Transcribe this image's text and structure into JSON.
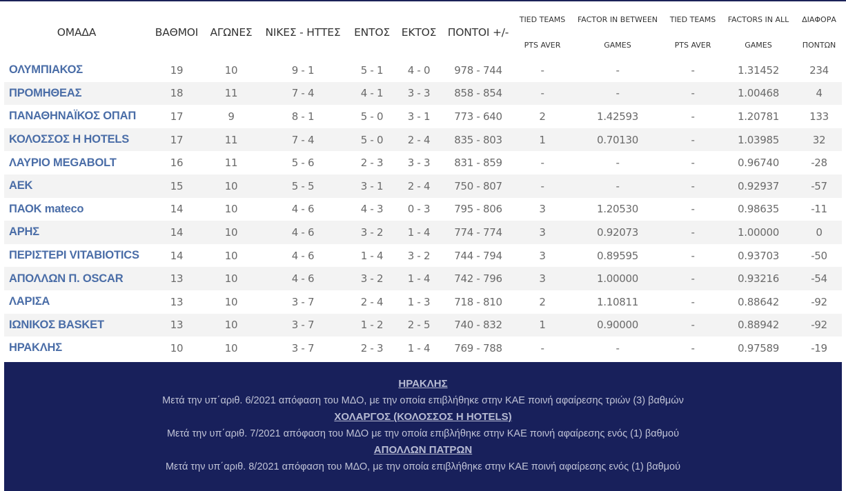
{
  "colors": {
    "team_link": "#4a6da7",
    "footer_bg": "#18205b",
    "row_stripe": "#f3f3f3"
  },
  "header": {
    "team": "ΟΜΑΔΑ",
    "points": "ΒΑΘΜΟΙ",
    "games": "ΑΓΩΝΕΣ",
    "win_loss": "ΝΙΚΕΣ - ΗΤΤΕΣ",
    "home": "ΕΝΤΟΣ",
    "away": "ΕΚΤΟΣ",
    "score": "ΠΟΝΤΟΙ +/-",
    "tied_teams_1_line1": "TIED TEAMS",
    "tied_teams_1_line2": "PTS AVER",
    "factor_between_line1": "FACTOR IN BETWEEN",
    "factor_between_line2": "GAMES",
    "tied_teams_2_line1": "TIED TEAMS",
    "tied_teams_2_line2": "PTS AVER",
    "factors_all_line1": "FACTORS IN ALL",
    "factors_all_line2": "GAMES",
    "diff_line1": "ΔΙΑΦΟΡΑ",
    "diff_line2": "ΠΟΝΤΩΝ"
  },
  "rows": [
    {
      "team": "ΟΛΥΜΠΙΑΚΟΣ",
      "points": "19",
      "games": "10",
      "wl": "9 - 1",
      "home": "5 - 1",
      "away": "4 - 0",
      "score": "978 - 744",
      "tied1": "-",
      "factor_between": "-",
      "tied2": "-",
      "factor_all": "1.31452",
      "diff": "234"
    },
    {
      "team": "ΠΡΟΜΗΘΕΑΣ",
      "points": "18",
      "games": "11",
      "wl": "7 - 4",
      "home": "4 - 1",
      "away": "3 - 3",
      "score": "858 - 854",
      "tied1": "-",
      "factor_between": "-",
      "tied2": "-",
      "factor_all": "1.00468",
      "diff": "4"
    },
    {
      "team": "ΠΑΝΑΘΗΝΑΪΚΟΣ ΟΠΑΠ",
      "points": "17",
      "games": "9",
      "wl": "8 - 1",
      "home": "5 - 0",
      "away": "3 - 1",
      "score": "773 - 640",
      "tied1": "2",
      "factor_between": "1.42593",
      "tied2": "-",
      "factor_all": "1.20781",
      "diff": "133"
    },
    {
      "team": "ΚΟΛΟΣΣΟΣ Η HOTELS",
      "points": "17",
      "games": "11",
      "wl": "7 - 4",
      "home": "5 - 0",
      "away": "2 - 4",
      "score": "835 - 803",
      "tied1": "1",
      "factor_between": "0.70130",
      "tied2": "-",
      "factor_all": "1.03985",
      "diff": "32"
    },
    {
      "team": "ΛΑΥΡΙΟ MEGABOLT",
      "points": "16",
      "games": "11",
      "wl": "5 - 6",
      "home": "2 - 3",
      "away": "3 - 3",
      "score": "831 - 859",
      "tied1": "-",
      "factor_between": "-",
      "tied2": "-",
      "factor_all": "0.96740",
      "diff": "-28"
    },
    {
      "team": "ΑΕΚ",
      "points": "15",
      "games": "10",
      "wl": "5 - 5",
      "home": "3 - 1",
      "away": "2 - 4",
      "score": "750 - 807",
      "tied1": "-",
      "factor_between": "-",
      "tied2": "-",
      "factor_all": "0.92937",
      "diff": "-57"
    },
    {
      "team": "ΠΑΟΚ mateco",
      "points": "14",
      "games": "10",
      "wl": "4 - 6",
      "home": "4 - 3",
      "away": "0 - 3",
      "score": "795 - 806",
      "tied1": "3",
      "factor_between": "1.20530",
      "tied2": "-",
      "factor_all": "0.98635",
      "diff": "-11"
    },
    {
      "team": "ΑΡΗΣ",
      "points": "14",
      "games": "10",
      "wl": "4 - 6",
      "home": "3 - 2",
      "away": "1 - 4",
      "score": "774 - 774",
      "tied1": "3",
      "factor_between": "0.92073",
      "tied2": "-",
      "factor_all": "1.00000",
      "diff": "0"
    },
    {
      "team": "ΠΕΡΙΣΤΕΡΙ VITABIOTICS",
      "points": "14",
      "games": "10",
      "wl": "4 - 6",
      "home": "1 - 4",
      "away": "3 - 2",
      "score": "744 - 794",
      "tied1": "3",
      "factor_between": "0.89595",
      "tied2": "-",
      "factor_all": "0.93703",
      "diff": "-50"
    },
    {
      "team": "ΑΠΟΛΛΩΝ Π. OSCAR",
      "points": "13",
      "games": "10",
      "wl": "4 - 6",
      "home": "3 - 2",
      "away": "1 - 4",
      "score": "742 - 796",
      "tied1": "3",
      "factor_between": "1.00000",
      "tied2": "-",
      "factor_all": "0.93216",
      "diff": "-54"
    },
    {
      "team": "ΛΑΡΙΣΑ",
      "points": "13",
      "games": "10",
      "wl": "3 - 7",
      "home": "2 - 4",
      "away": "1 - 3",
      "score": "718 - 810",
      "tied1": "2",
      "factor_between": "1.10811",
      "tied2": "-",
      "factor_all": "0.88642",
      "diff": "-92"
    },
    {
      "team": "ΙΩΝΙΚΟΣ BASKET",
      "points": "13",
      "games": "10",
      "wl": "3 - 7",
      "home": "1 - 2",
      "away": "2 - 5",
      "score": "740 - 832",
      "tied1": "1",
      "factor_between": "0.90000",
      "tied2": "-",
      "factor_all": "0.88942",
      "diff": "-92"
    },
    {
      "team": "ΗΡΑΚΛΗΣ",
      "points": "10",
      "games": "10",
      "wl": "3 - 7",
      "home": "2 - 3",
      "away": "1 - 4",
      "score": "769 - 788",
      "tied1": "-",
      "factor_between": "-",
      "tied2": "-",
      "factor_all": "0.97589",
      "diff": "-19"
    }
  ],
  "notes": [
    {
      "title": "ΗΡΑΚΛΗΣ",
      "text": "Μετά την υπ΄αριθ. 6/2021 απόφαση του ΜΔΟ, με την οποία επιβλήθηκε στην ΚΑΕ ποινή αφαίρεσης τριών (3) βαθμών"
    },
    {
      "title": "ΧΟΛΑΡΓΟΣ (ΚΟΛΟΣΣΟΣ Η HOTELS)",
      "text": "Μετά την υπ΄αριθ. 7/2021 απόφαση του ΜΔΟ  με την οποία επιβλήθηκε στην ΚΑΕ ποινή αφαίρεσης ενός (1) βαθμού"
    },
    {
      "title": "ΑΠΟΛΛΩΝ ΠΑΤΡΩΝ",
      "text": "Μετά την υπ΄αριθ. 8/2021 απόφαση του ΜΔΟ, με την οποία επιβλήθηκε στην ΚΑΕ ποινή αφαίρεσης ενός (1) βαθμού"
    }
  ]
}
